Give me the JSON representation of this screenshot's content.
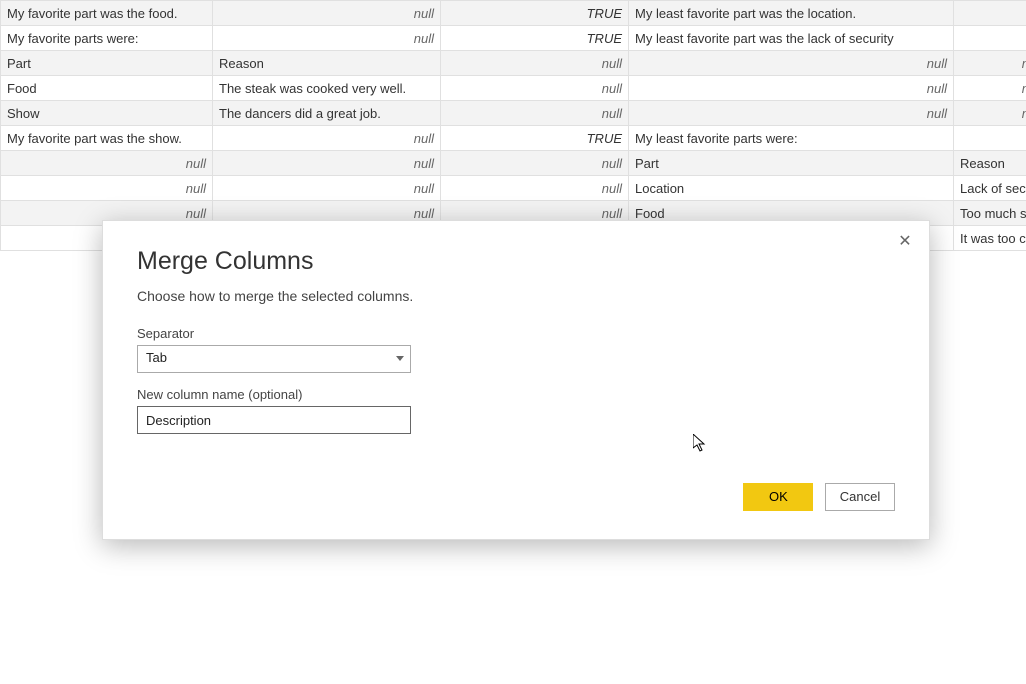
{
  "table": {
    "rows": [
      {
        "c1": "My favorite part was the food.",
        "c1null": false,
        "c2": "null",
        "c2null": true,
        "c3": "TRUE",
        "c3true": true,
        "c4": "My least favorite part was the location.",
        "c4null": false,
        "c5": "",
        "c5null": false
      },
      {
        "c1": "My favorite parts were:",
        "c1null": false,
        "c2": "null",
        "c2null": true,
        "c3": "TRUE",
        "c3true": true,
        "c4": "My least favorite part was  the lack of security",
        "c4null": false,
        "c5": "",
        "c5null": false
      },
      {
        "c1": "Part",
        "c1null": false,
        "c2": "Reason",
        "c2null": false,
        "c3": "null",
        "c3true": false,
        "c4": "null",
        "c4null": true,
        "c5": "null",
        "c5null": true
      },
      {
        "c1": "Food",
        "c1null": false,
        "c2": "The steak was cooked very well.",
        "c2null": false,
        "c3": "null",
        "c3true": false,
        "c4": "null",
        "c4null": true,
        "c5": "null",
        "c5null": true
      },
      {
        "c1": "Show",
        "c1null": false,
        "c2": "The dancers did a great job.",
        "c2null": false,
        "c3": "null",
        "c3true": false,
        "c4": "null",
        "c4null": true,
        "c5": "null",
        "c5null": true
      },
      {
        "c1": "My favorite part was the show.",
        "c1null": false,
        "c2": "null",
        "c2null": true,
        "c3": "TRUE",
        "c3true": true,
        "c4": "My least favorite parts were:",
        "c4null": false,
        "c5": "",
        "c5null": false
      },
      {
        "c1": "null",
        "c1null": true,
        "c2": "null",
        "c2null": true,
        "c3": "null",
        "c3true": false,
        "c4": "Part",
        "c4null": false,
        "c5": "Reason",
        "c5null": false
      },
      {
        "c1": "null",
        "c1null": true,
        "c2": "null",
        "c2null": true,
        "c3": "null",
        "c3true": false,
        "c4": "Location",
        "c4null": false,
        "c5": "Lack of security",
        "c5null": false
      },
      {
        "c1": "null",
        "c1null": true,
        "c2": "null",
        "c2null": true,
        "c3": "null",
        "c3true": false,
        "c4": "Food",
        "c4null": false,
        "c5": "Too much salt",
        "c5null": false
      },
      {
        "c1": "",
        "c1null": false,
        "c2": "",
        "c2null": false,
        "c3": "",
        "c3true": false,
        "c4": "",
        "c4null": false,
        "c5": "It was too cold",
        "c5null": false
      }
    ]
  },
  "dialog": {
    "title": "Merge Columns",
    "subtitle": "Choose how to merge the selected columns.",
    "sep_label": "Separator",
    "sep_value": "Tab",
    "name_label": "New column name (optional)",
    "name_value": "Description",
    "ok": "OK",
    "cancel": "Cancel"
  }
}
